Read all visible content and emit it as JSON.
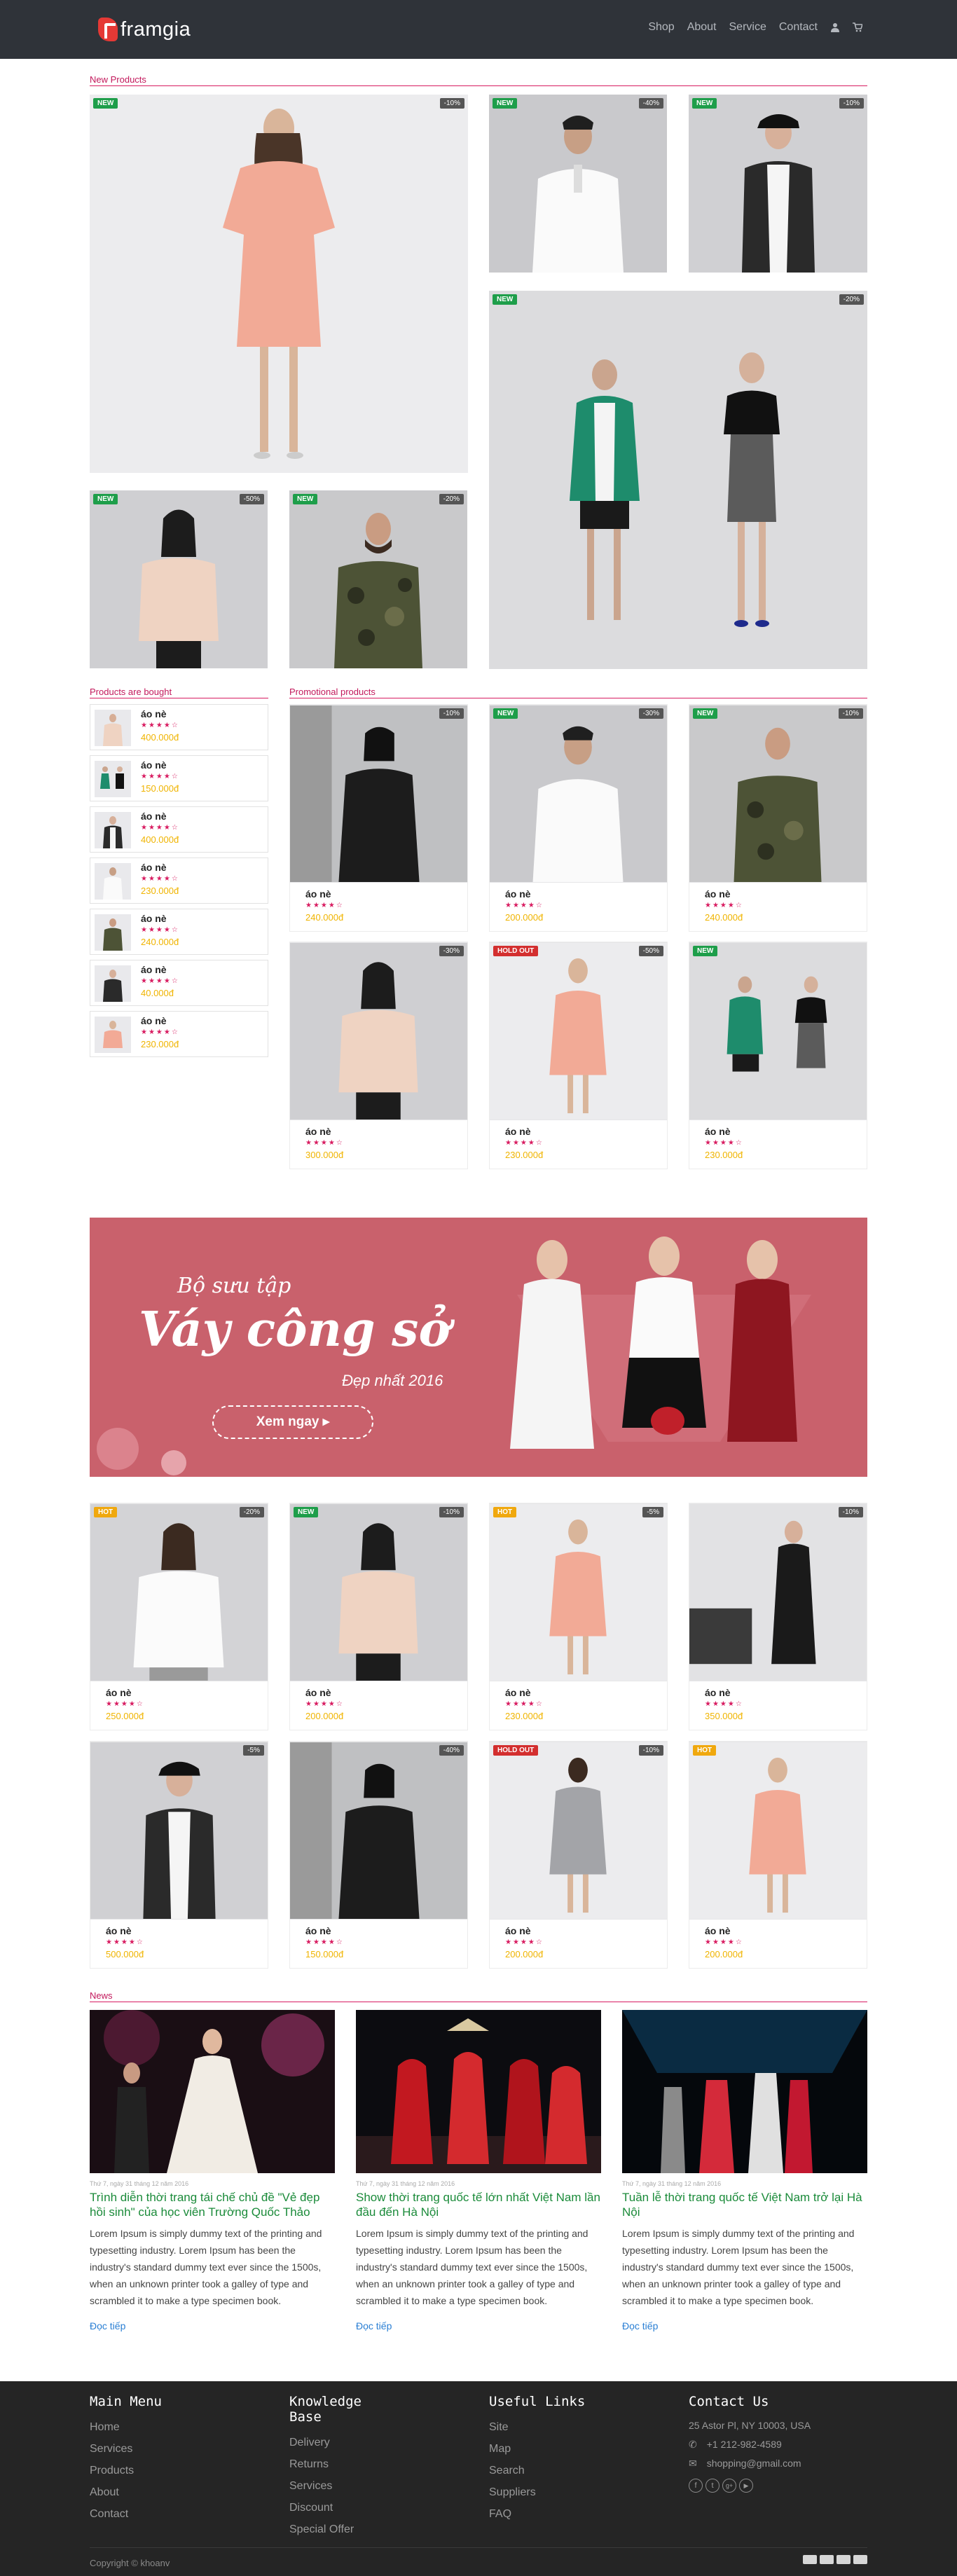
{
  "brand": "framgia",
  "nav": [
    "Shop",
    "About",
    "Service",
    "Contact"
  ],
  "sections": {
    "new_products": "New Products",
    "bought": "Products are bought",
    "promo": "Promotional products",
    "news": "News"
  },
  "new_products": [
    {
      "badge": "NEW",
      "discount": "-10%"
    },
    {
      "badge": "NEW",
      "discount": "-40%"
    },
    {
      "badge": "NEW",
      "discount": "-10%"
    },
    {
      "badge": "NEW",
      "discount": "-20%"
    },
    {
      "badge": "NEW",
      "discount": "-50%"
    },
    {
      "badge": "NEW",
      "discount": "-20%"
    }
  ],
  "bought": [
    {
      "name": "áo nè",
      "price": "400.000đ"
    },
    {
      "name": "áo nè",
      "price": "150.000đ"
    },
    {
      "name": "áo nè",
      "price": "400.000đ"
    },
    {
      "name": "áo nè",
      "price": "230.000đ"
    },
    {
      "name": "áo nè",
      "price": "240.000đ"
    },
    {
      "name": "áo nè",
      "price": "40.000đ"
    },
    {
      "name": "áo nè",
      "price": "230.000đ"
    }
  ],
  "promo": [
    {
      "badge": "",
      "discount": "-10%",
      "name": "áo nè",
      "price": "240.000đ"
    },
    {
      "badge": "NEW",
      "discount": "-30%",
      "name": "áo nè",
      "price": "200.000đ"
    },
    {
      "badge": "NEW",
      "discount": "-10%",
      "name": "áo nè",
      "price": "240.000đ"
    },
    {
      "badge": "",
      "discount": "-30%",
      "name": "áo nè",
      "price": "300.000đ"
    },
    {
      "badge": "HOLD OUT",
      "discount": "-50%",
      "name": "áo nè",
      "price": "230.000đ"
    },
    {
      "badge": "NEW",
      "discount": "",
      "name": "áo nè",
      "price": "230.000đ"
    }
  ],
  "banner": {
    "line1": "Bộ sưu tập",
    "line2": "Váy công sở",
    "line3": "Đẹp nhất 2016",
    "button": "Xem ngay ▸"
  },
  "grid": [
    {
      "badge": "HOT",
      "discount": "-20%",
      "name": "áo nè",
      "price": "250.000đ"
    },
    {
      "badge": "NEW",
      "discount": "-10%",
      "name": "áo nè",
      "price": "200.000đ"
    },
    {
      "badge": "HOT",
      "discount": "-5%",
      "name": "áo nè",
      "price": "230.000đ"
    },
    {
      "badge": "",
      "discount": "-10%",
      "name": "áo nè",
      "price": "350.000đ"
    },
    {
      "badge": "",
      "discount": "-5%",
      "name": "áo nè",
      "price": "500.000đ"
    },
    {
      "badge": "",
      "discount": "-40%",
      "name": "áo nè",
      "price": "150.000đ"
    },
    {
      "badge": "HOLD OUT",
      "discount": "-10%",
      "name": "áo nè",
      "price": "200.000đ"
    },
    {
      "badge": "HOT",
      "discount": "",
      "name": "áo nè",
      "price": "200.000đ"
    }
  ],
  "news": [
    {
      "meta": "Thứ 7, ngày 31 tháng 12 năm 2016",
      "title": "Trình diễn thời trang tái chế chủ đề \"Vẻ đẹp hồi sinh\" của học viên Trường Quốc Thảo",
      "body": "Lorem Ipsum is simply dummy text of the printing and typesetting industry. Lorem Ipsum has been the industry's standard dummy text ever since the 1500s, when an unknown printer took a galley of type and scrambled it to make a type specimen book.",
      "more": "Đọc tiếp"
    },
    {
      "meta": "Thứ 7, ngày 31 tháng 12 năm 2016",
      "title": "Show thời trang quốc tế lớn nhất Việt Nam lần đầu đến Hà Nội",
      "body": "Lorem Ipsum is simply dummy text of the printing and typesetting industry. Lorem Ipsum has been the industry's standard dummy text ever since the 1500s, when an unknown printer took a galley of type and scrambled it to make a type specimen book.",
      "more": "Đọc tiếp"
    },
    {
      "meta": "Thứ 7, ngày 31 tháng 12 năm 2016",
      "title": "Tuần lễ thời trang quốc tế Việt Nam trở lại Hà Nội",
      "body": "Lorem Ipsum is simply dummy text of the printing and typesetting industry. Lorem Ipsum has been the industry's standard dummy text ever since the 1500s, when an unknown printer took a galley of type and scrambled it to make a type specimen book.",
      "more": "Đọc tiếp"
    }
  ],
  "footer": {
    "main_menu": {
      "title": "Main Menu",
      "items": [
        "Home",
        "Services",
        "Products",
        "About",
        "Contact"
      ]
    },
    "knowledge": {
      "title": "Knowledge Base",
      "items": [
        "Delivery",
        "Returns",
        "Services",
        "Discount",
        "Special Offer"
      ]
    },
    "useful": {
      "title": "Useful Links",
      "items": [
        "Site",
        "Map",
        "Search",
        "Suppliers",
        "FAQ"
      ]
    },
    "contact": {
      "title": "Contact Us",
      "address": "25 Astor Pl, NY 10003, USA",
      "phone": "+1 212-982-4589",
      "email": "shopping@gmail.com"
    },
    "copyright": "Copyright © khoanv"
  },
  "colors": {
    "header": "#2f3339",
    "accent": "#d81b60",
    "price": "#f0b400",
    "new": "#1e9e4a",
    "hot": "#f0a80e",
    "hold": "#d32f2f",
    "banner": "#c9616c",
    "footer": "#252525"
  }
}
